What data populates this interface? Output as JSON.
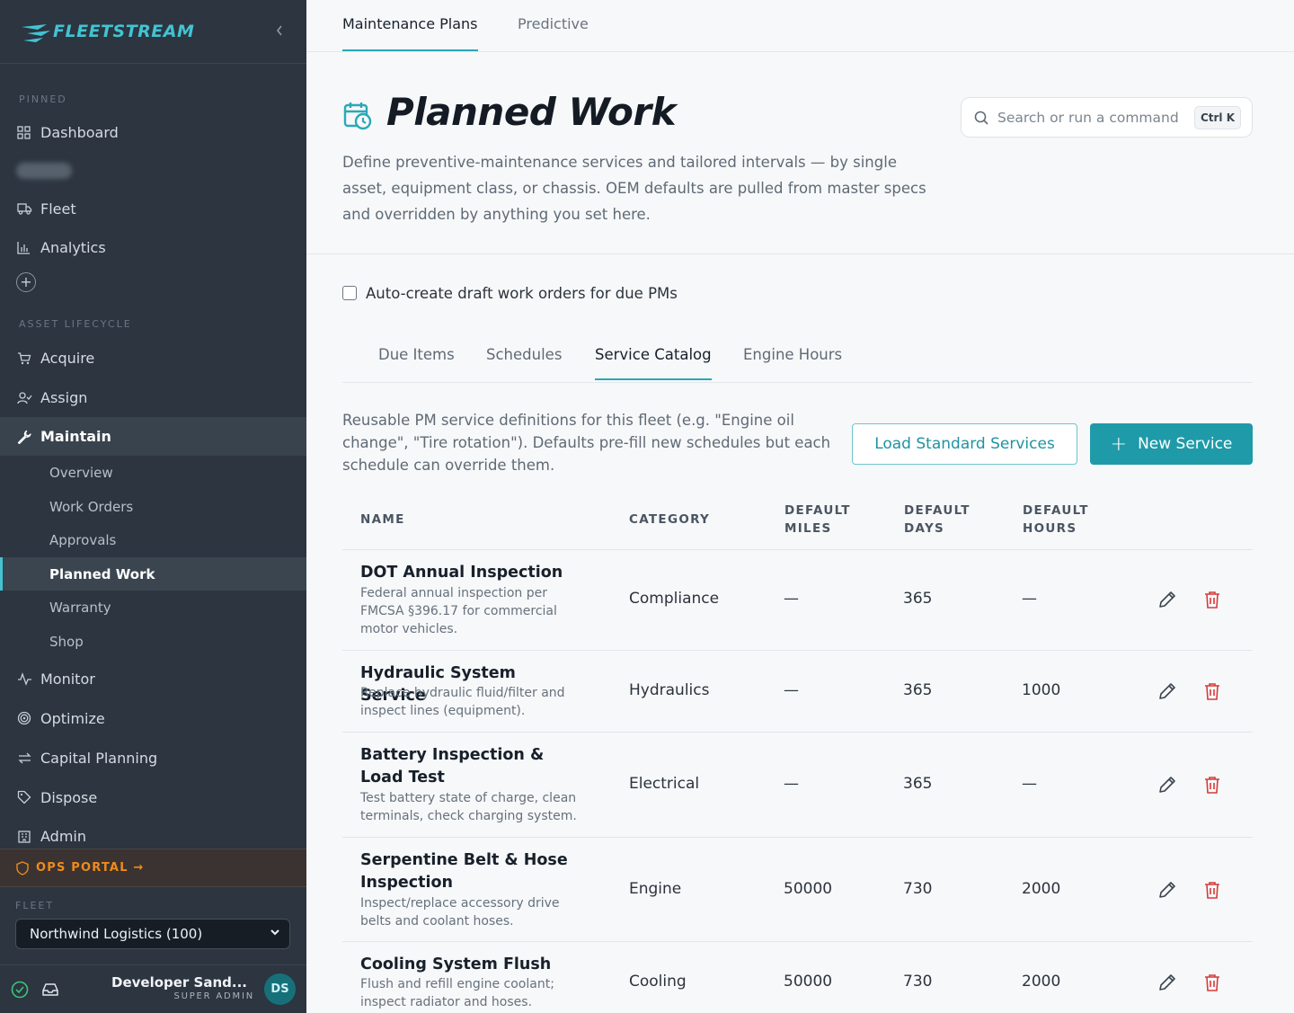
{
  "app": {
    "brand": "FLEETSTREAM",
    "accent": "#2aa8b6",
    "sidebar_bg": "#2c3540",
    "danger": "#d63a3a",
    "ops_color": "#f08a1c"
  },
  "sidebar": {
    "pinned_label": "PINNED",
    "pinned_items": [
      {
        "label": "Dashboard",
        "icon": "grid-icon"
      },
      {
        "label": "Fleet",
        "icon": "truck-icon"
      },
      {
        "label": "Analytics",
        "icon": "bar-chart-icon"
      }
    ],
    "lifecycle_label": "ASSET LIFECYCLE",
    "lifecycle_items": [
      {
        "label": "Acquire",
        "icon": "cart-icon"
      },
      {
        "label": "Assign",
        "icon": "user-check-icon"
      },
      {
        "label": "Maintain",
        "icon": "wrench-icon",
        "active": true
      },
      {
        "label": "Monitor",
        "icon": "activity-icon"
      },
      {
        "label": "Optimize",
        "icon": "target-icon"
      },
      {
        "label": "Capital Planning",
        "icon": "swap-icon"
      },
      {
        "label": "Dispose",
        "icon": "tag-icon"
      },
      {
        "label": "Admin",
        "icon": "building-icon"
      }
    ],
    "maintain_sub": [
      "Overview",
      "Work Orders",
      "Approvals",
      "Planned Work",
      "Warranty",
      "Shop"
    ],
    "active_sub": "Planned Work",
    "ops_portal": "OPS PORTAL →",
    "fleet_label": "FLEET",
    "fleet_selected": "Northwind Logistics (100)",
    "user": {
      "name": "Developer Sand...",
      "role": "SUPER ADMIN",
      "initials": "DS"
    }
  },
  "top_tabs": [
    "Maintenance Plans",
    "Predictive"
  ],
  "active_top_tab": "Maintenance Plans",
  "header": {
    "title": "Planned Work",
    "description": "Define preventive-maintenance services and tailored intervals — by single asset, equipment class, or chassis. OEM defaults are pulled from master specs and overridden by anything you set here.",
    "search_placeholder": "Search or run a command",
    "search_shortcut": "Ctrl K"
  },
  "auto_create_label": "Auto-create draft work orders for due PMs",
  "auto_create_checked": false,
  "sub_tabs": [
    "Due Items",
    "Schedules",
    "Service Catalog",
    "Engine Hours"
  ],
  "active_sub_tab": "Service Catalog",
  "catalog": {
    "description": "Reusable PM service definitions for this fleet (e.g. \"Engine oil change\", \"Tire rotation\"). Defaults pre-fill new schedules but each schedule can override them.",
    "load_button": "Load Standard Services",
    "new_button": "New Service",
    "columns": [
      "NAME",
      "CATEGORY",
      "DEFAULT MILES",
      "DEFAULT DAYS",
      "DEFAULT HOURS"
    ],
    "rows": [
      {
        "name": "DOT Annual Inspection",
        "description": "Federal annual inspection per FMCSA §396.17 for commercial motor vehicles.",
        "category": "Compliance",
        "miles": "—",
        "days": "365",
        "hours": "—"
      },
      {
        "name": "Hydraulic System Service",
        "description": "Replace hydraulic fluid/filter and inspect lines (equipment).",
        "category": "Hydraulics",
        "miles": "—",
        "days": "365",
        "hours": "1000"
      },
      {
        "name": "Battery Inspection & Load Test",
        "description": "Test battery state of charge, clean terminals, check charging system.",
        "category": "Electrical",
        "miles": "—",
        "days": "365",
        "hours": "—"
      },
      {
        "name": "Serpentine Belt & Hose Inspection",
        "description": "Inspect/replace accessory drive belts and coolant hoses.",
        "category": "Engine",
        "miles": "50000",
        "days": "730",
        "hours": "2000"
      },
      {
        "name": "Cooling System Flush",
        "description": "Flush and refill engine coolant; inspect radiator and hoses.",
        "category": "Cooling",
        "miles": "50000",
        "days": "730",
        "hours": "2000"
      }
    ]
  }
}
